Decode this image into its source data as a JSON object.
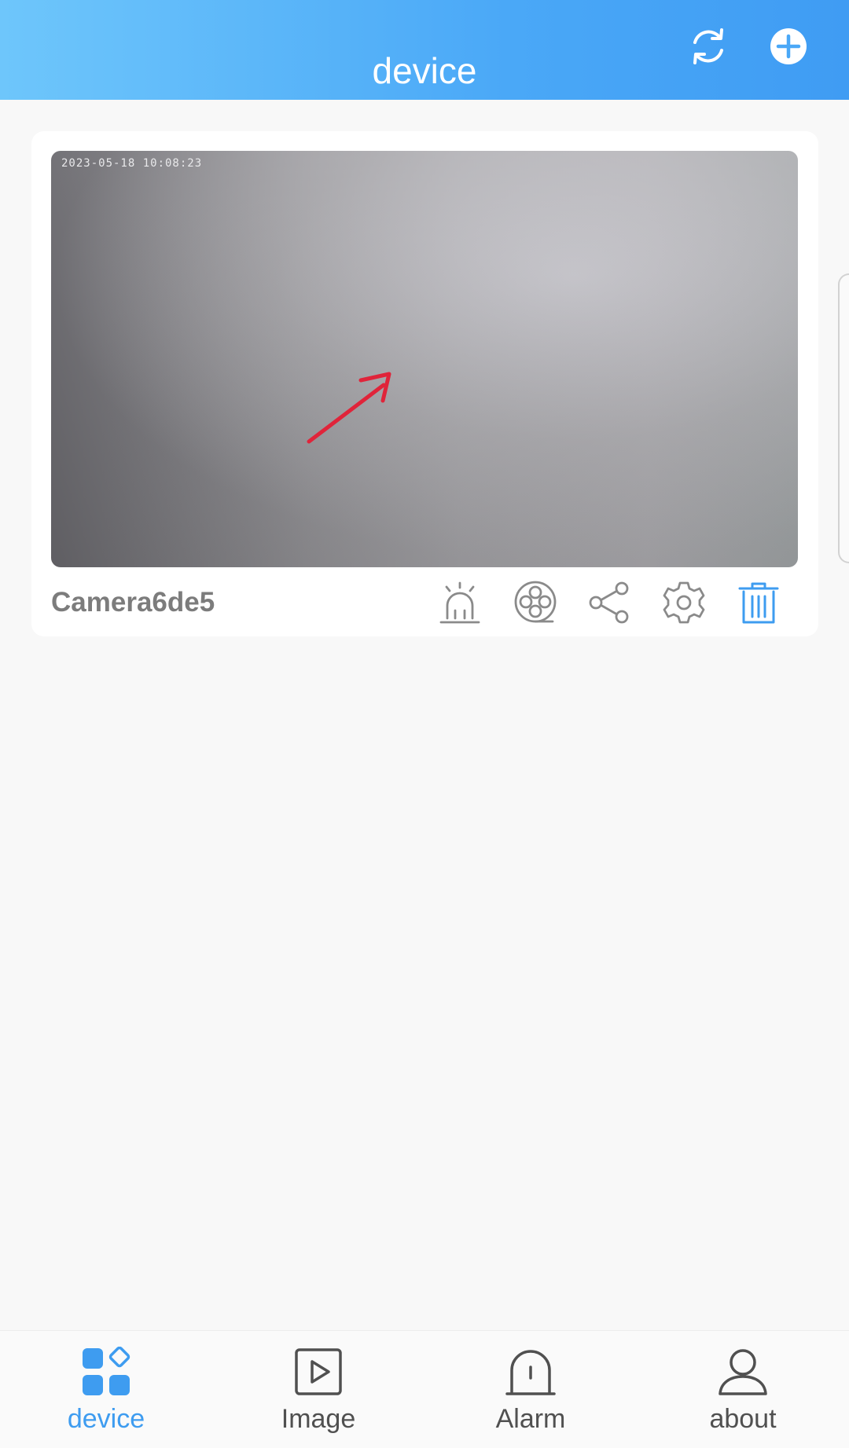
{
  "header": {
    "title": "device",
    "refresh_icon": "refresh-icon",
    "add_icon": "plus-circle-icon"
  },
  "device_card": {
    "name": "Camera6de5",
    "timestamp": "2023-05-18 10:08:23",
    "actions": [
      {
        "id": "alarm",
        "icon": "siren-icon"
      },
      {
        "id": "record",
        "icon": "film-reel-icon"
      },
      {
        "id": "share",
        "icon": "share-icon"
      },
      {
        "id": "settings",
        "icon": "gear-icon"
      },
      {
        "id": "delete",
        "icon": "trash-icon"
      }
    ]
  },
  "bottom_nav": {
    "items": [
      {
        "label": "device",
        "icon": "grid-icon",
        "active": true
      },
      {
        "label": "Image",
        "icon": "play-square-icon",
        "active": false
      },
      {
        "label": "Alarm",
        "icon": "alarm-icon",
        "active": false
      },
      {
        "label": "about",
        "icon": "user-icon",
        "active": false
      }
    ]
  },
  "colors": {
    "accent": "#3e9cf0",
    "header_start": "#6ec6fb",
    "header_end": "#3f9cf3",
    "arrow": "#e0243a",
    "icon_gray": "#8a8a8a"
  }
}
